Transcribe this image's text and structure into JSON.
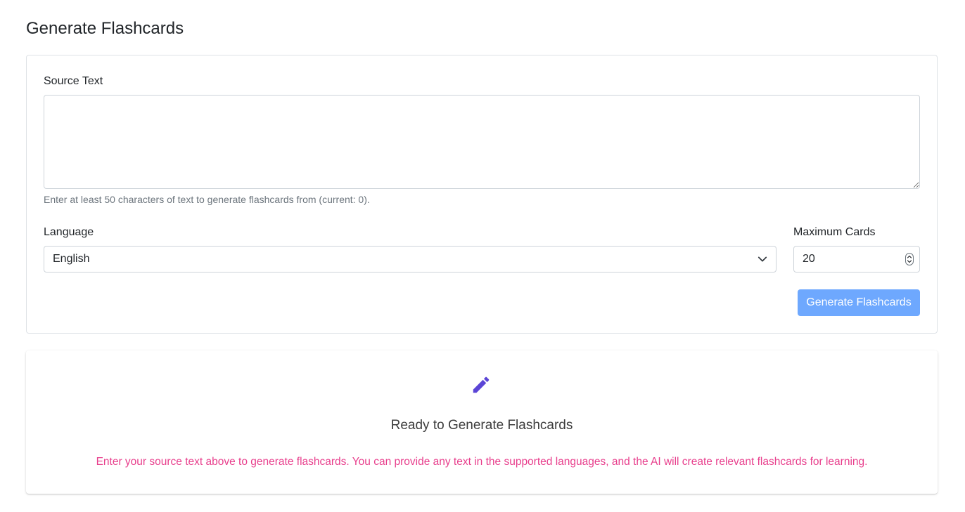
{
  "page": {
    "title": "Generate Flashcards"
  },
  "form": {
    "source_label": "Source Text",
    "source_value": "",
    "source_help": "Enter at least 50 characters of text to generate flashcards from (current: 0).",
    "language_label": "Language",
    "language_value": "English",
    "max_cards_label": "Maximum Cards",
    "max_cards_value": "20",
    "submit_label": "Generate Flashcards"
  },
  "empty_state": {
    "icon": "pencil-icon",
    "title": "Ready to Generate Flashcards",
    "message": "Enter your source text above to generate flashcards. You can provide any text in the supported languages, and the AI will create relevant flashcards for learning."
  },
  "colors": {
    "primary_button": "#6ea8fe",
    "icon_accent": "#5b45d6",
    "message_text": "#e83e8c",
    "help_text": "#6c757d"
  }
}
